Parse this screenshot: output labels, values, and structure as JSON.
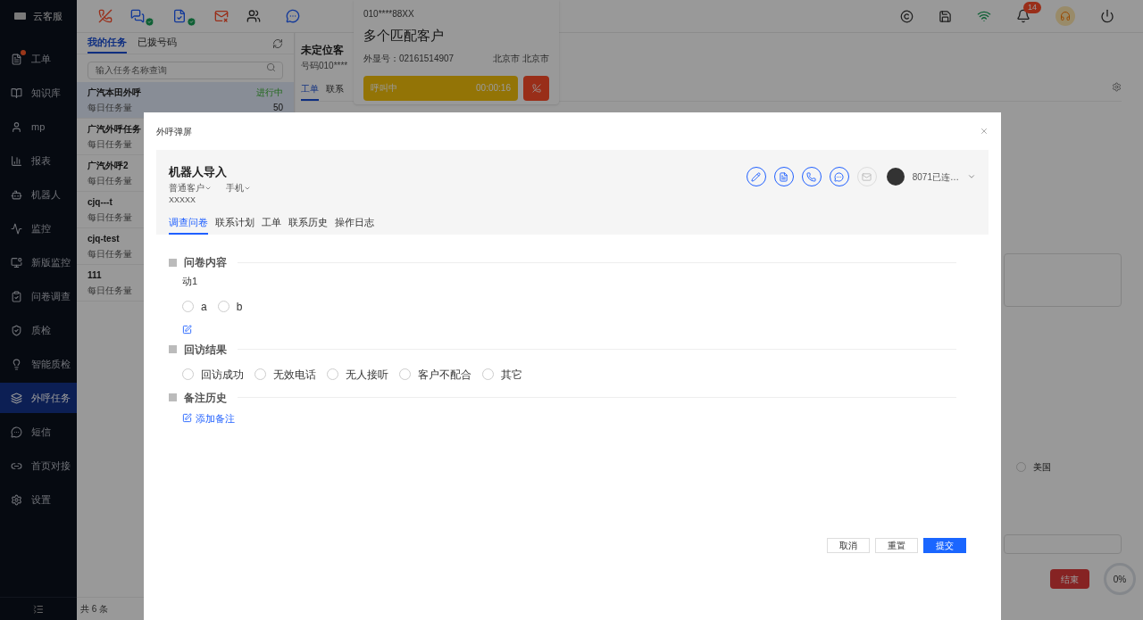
{
  "sidebar": {
    "logo": "云客服",
    "items": [
      {
        "label": "工单",
        "selected": false,
        "dot": true
      },
      {
        "label": "知识库",
        "selected": false,
        "dot": false
      },
      {
        "label": "mp",
        "selected": false,
        "dot": false
      },
      {
        "label": "报表",
        "selected": false,
        "dot": false
      },
      {
        "label": "机器人",
        "selected": false,
        "dot": false
      },
      {
        "label": "监控",
        "selected": false,
        "dot": false
      },
      {
        "label": "新版监控",
        "selected": false,
        "dot": false
      },
      {
        "label": "问卷调查",
        "selected": false,
        "dot": false
      },
      {
        "label": "质检",
        "selected": false,
        "dot": false
      },
      {
        "label": "智能质检",
        "selected": false,
        "dot": false
      },
      {
        "label": "外呼任务",
        "selected": true,
        "dot": false
      },
      {
        "label": "短信",
        "selected": false,
        "dot": false
      },
      {
        "label": "首页对接",
        "selected": false,
        "dot": false
      },
      {
        "label": "设置",
        "selected": false,
        "dot": false
      }
    ]
  },
  "top_bar": {
    "notification_count": "14"
  },
  "task_panel": {
    "tabs": [
      {
        "label": "我的任务",
        "selected": true
      },
      {
        "label": "已拨号码",
        "selected": false
      }
    ],
    "search": {
      "placeholder": "输入任务名称查询"
    },
    "tasks": [
      {
        "name": "广汽本田外呼",
        "status": "进行中",
        "sublabel": "每日任务量",
        "count": "50",
        "selected": true
      },
      {
        "name": "广汽外呼任务",
        "sublabel": "每日任务量",
        "selected": false
      },
      {
        "name": "广汽外呼2",
        "sublabel": "每日任务量",
        "selected": false
      },
      {
        "name": "cjq---t",
        "sublabel": "每日任务量",
        "selected": false
      },
      {
        "name": "cjq-test",
        "sublabel": "每日任务量",
        "selected": false
      },
      {
        "name": "111",
        "sublabel": "每日任务量",
        "selected": false
      }
    ],
    "footer": "共 6 条"
  },
  "main": {
    "title": "未定位客",
    "subtitle": "号码010****",
    "tabs": [
      {
        "label": "工单",
        "selected": true
      },
      {
        "label": "联系",
        "selected": false
      }
    ],
    "radio_option": {
      "label": "美国",
      "selected": false
    },
    "end_button": "结束",
    "progress": "0%"
  },
  "call_popup": {
    "number": "010****88XX",
    "title": "多个匹配客户",
    "caller_id": "外显号：02161514907",
    "location": "北京市 北京市",
    "status": "呼叫中",
    "timer": "00:00:16"
  },
  "dialog": {
    "title": "外呼弹屏",
    "customer": {
      "name": "机器人导入",
      "type": "普通客户",
      "phone_type": "手机",
      "value": "XXXXX"
    },
    "agent": "8071已连…",
    "tabs": [
      {
        "label": "调查问卷",
        "selected": true
      },
      {
        "label": "联系计划",
        "selected": false
      },
      {
        "label": "工单",
        "selected": false
      },
      {
        "label": "联系历史",
        "selected": false
      },
      {
        "label": "操作日志",
        "selected": false
      }
    ],
    "sections": [
      {
        "kind": "question",
        "title": "问卷内容",
        "question": "动1",
        "options": [
          {
            "label": "a",
            "selected": false
          },
          {
            "label": "b",
            "selected": false
          }
        ]
      },
      {
        "kind": "choice",
        "title": "回访结果",
        "options": [
          {
            "label": "回访成功",
            "selected": false
          },
          {
            "label": "无效电话",
            "selected": false
          },
          {
            "label": "无人接听",
            "selected": false
          },
          {
            "label": "客户不配合",
            "selected": false
          },
          {
            "label": "其它",
            "selected": false
          }
        ]
      },
      {
        "kind": "notes",
        "title": "备注历史",
        "link": "添加备注"
      }
    ],
    "buttons": [
      {
        "label": "取消",
        "kind": "default"
      },
      {
        "label": "重置",
        "kind": "default"
      },
      {
        "label": "提交",
        "kind": "primary"
      }
    ]
  }
}
